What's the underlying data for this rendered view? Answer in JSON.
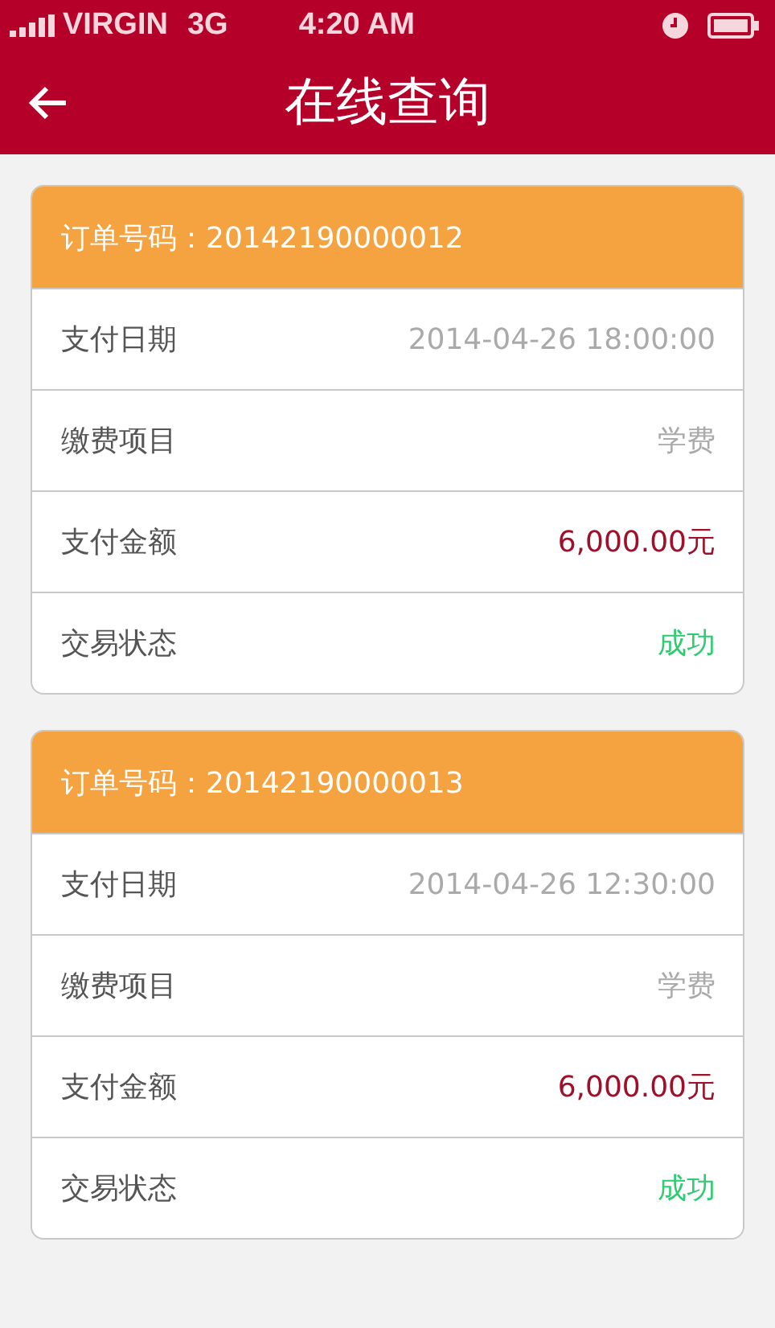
{
  "status_bar": {
    "carrier": "VIRGIN",
    "network": "3G",
    "time": "4:20 AM"
  },
  "header": {
    "title": "在线查询"
  },
  "orders": [
    {
      "number": "订单号码：20142190000012",
      "rows": [
        {
          "kind": "date",
          "label": "支付日期",
          "value": "2014-04-26 18:00:00"
        },
        {
          "kind": "item",
          "label": "缴费项目",
          "value": "学费"
        },
        {
          "kind": "amount",
          "label": "支付金额",
          "value": "6,000.00元"
        },
        {
          "kind": "status",
          "label": "交易状态",
          "value": "成功"
        }
      ]
    },
    {
      "number": "订单号码：20142190000013",
      "rows": [
        {
          "kind": "date",
          "label": "支付日期",
          "value": "2014-04-26 12:30:00"
        },
        {
          "kind": "item",
          "label": "缴费项目",
          "value": "学费"
        },
        {
          "kind": "amount",
          "label": "支付金额",
          "value": "6,000.00元"
        },
        {
          "kind": "status",
          "label": "交易状态",
          "value": "成功"
        }
      ]
    }
  ]
}
